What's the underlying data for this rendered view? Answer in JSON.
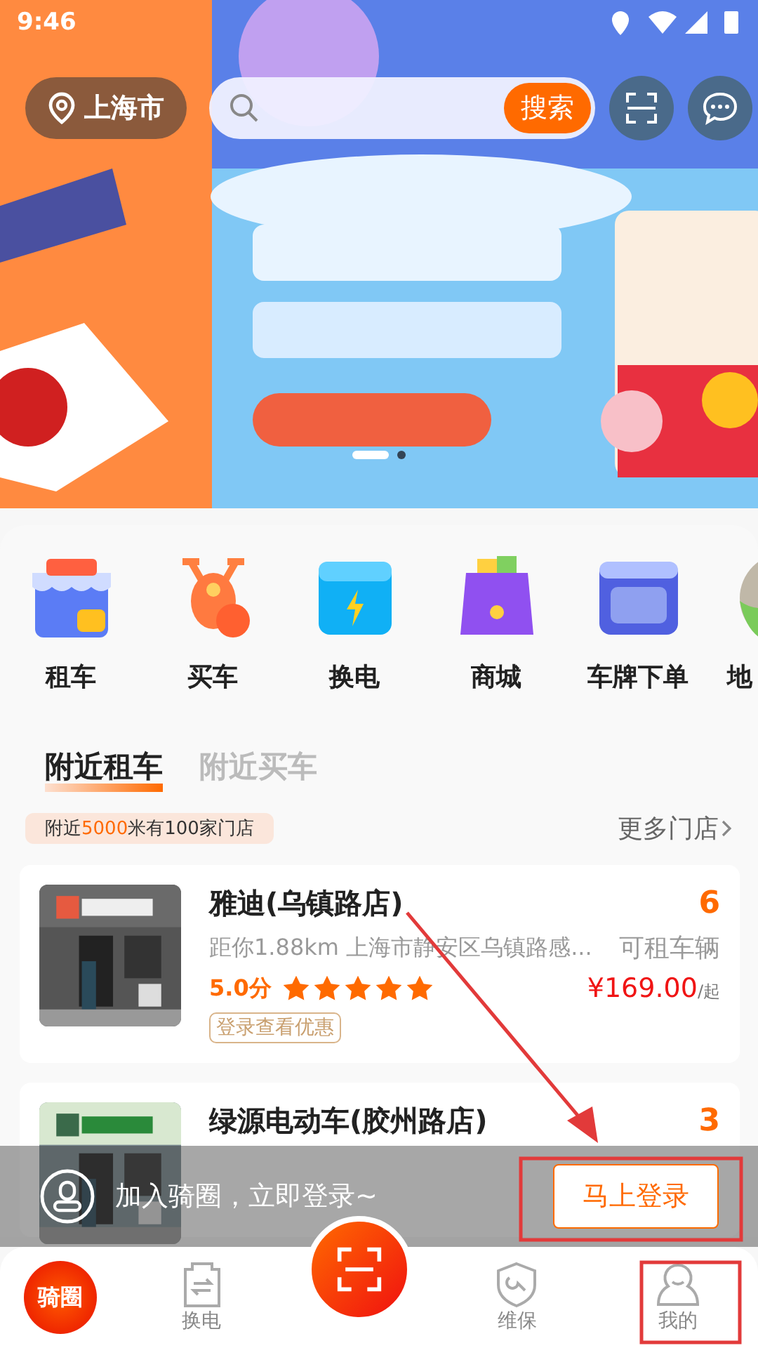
{
  "status_bar": {
    "time": "9:46"
  },
  "header": {
    "location": "上海市",
    "search_button": "搜索"
  },
  "banner": {
    "kind": "picture",
    "pages": [
      {
        "selected": true
      },
      {
        "selected": false
      }
    ]
  },
  "services": [
    {
      "label": "租车",
      "kind": "rent"
    },
    {
      "label": "买车",
      "kind": "buy"
    },
    {
      "label": "换电",
      "kind": "battery"
    },
    {
      "label": "商城",
      "kind": "shop"
    },
    {
      "label": "车牌下单",
      "kind": "plate"
    },
    {
      "label": "地",
      "kind": "map"
    }
  ],
  "tabs": [
    {
      "label": "附近租车",
      "selected": true
    },
    {
      "label": "附近买车",
      "selected": false
    }
  ],
  "summary": "附近**5000**米有100家门店",
  "more_link": "更多门店",
  "stores": [
    {
      "name": "雅迪(乌镇路店)",
      "distance": "距你1.88km",
      "address": "上海市静安区乌镇路感...",
      "count": "6",
      "count_label": "可租车辆",
      "rating": "5.0分",
      "stars": 5,
      "price": "¥169.00",
      "price_unit": "/起",
      "promo": "登录查看优惠"
    },
    {
      "name": "绿源电动车(胶州路店)",
      "count": "3"
    }
  ],
  "login_bar": {
    "text": "加入骑圈，立即登录~",
    "button": "马上登录"
  },
  "bottom_nav": [
    {
      "kind": "logo",
      "logo": "骑圈"
    },
    {
      "label": "换电",
      "kind": "swap",
      "selected": false
    },
    {
      "kind": "scan"
    },
    {
      "label": "维保",
      "kind": "repair",
      "selected": false
    },
    {
      "label": "我的",
      "kind": "me",
      "selected": false
    }
  ]
}
